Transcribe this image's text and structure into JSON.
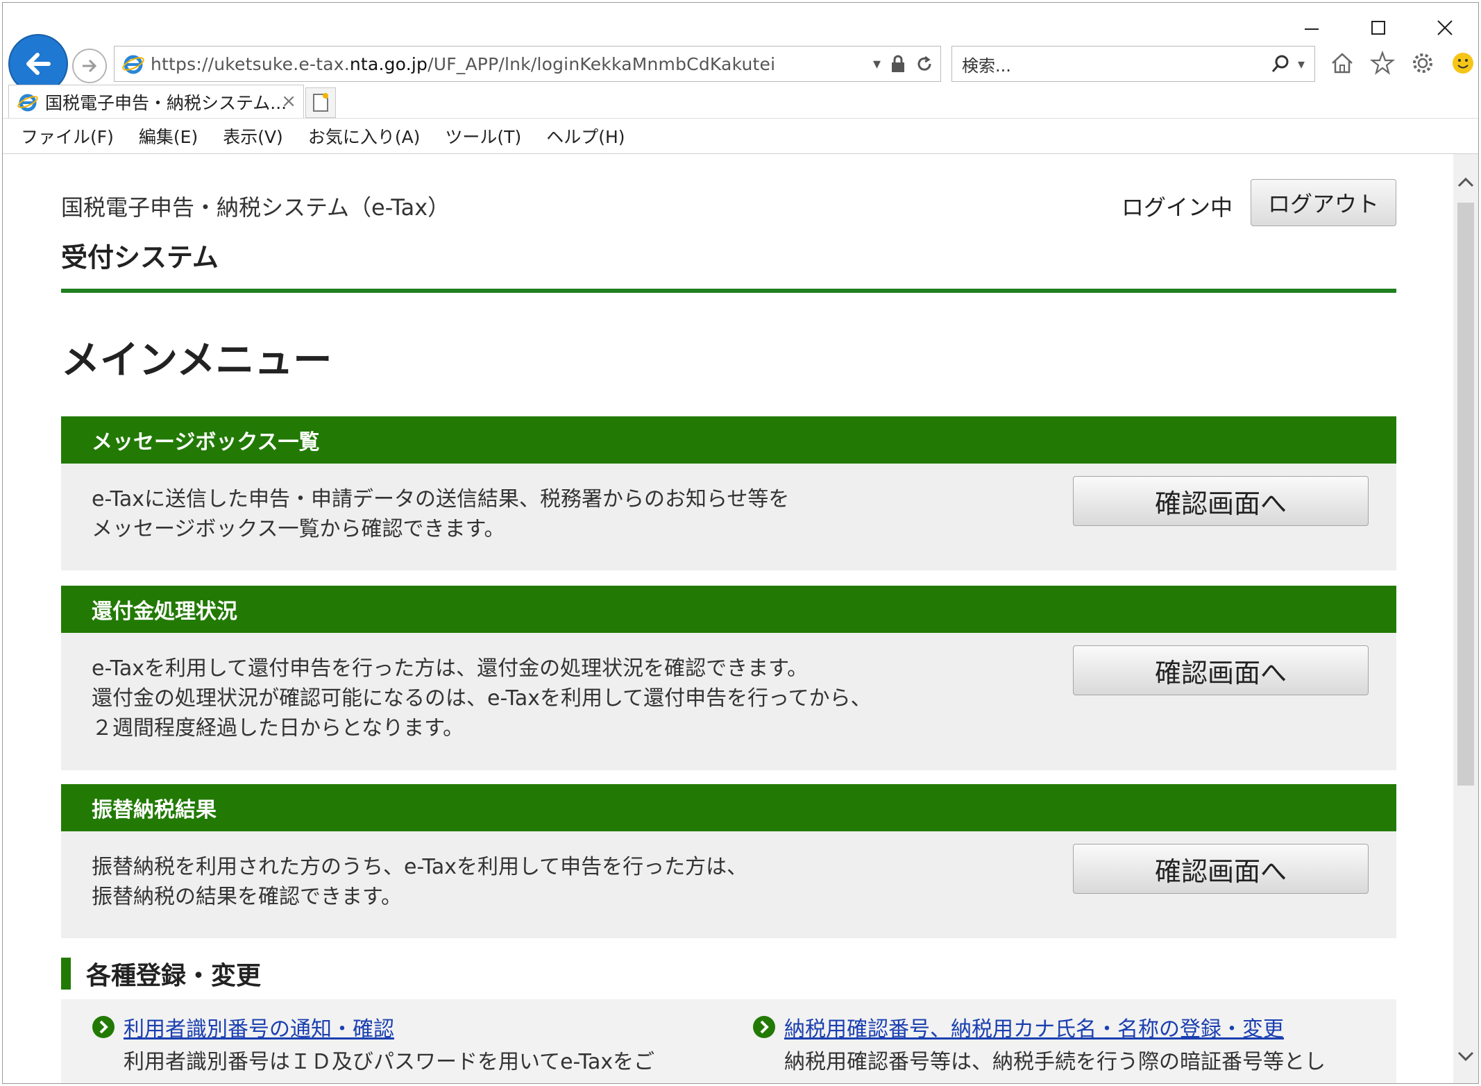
{
  "browser": {
    "url_prefix": "https://uketsuke.e-tax.",
    "url_domain": "nta.go.jp",
    "url_path": "/UF_APP/lnk/loginKekkaMnmbCdKakutei",
    "search_placeholder": "検索...",
    "tab_title": "国税電子申告・納税システム...",
    "menu": [
      "ファイル(F)",
      "編集(E)",
      "表示(V)",
      "お気に入り(A)",
      "ツール(T)",
      "ヘルプ(H)"
    ],
    "tab_close": "×",
    "address_dropdown": "▾"
  },
  "header": {
    "system_title": "国税電子申告・納税システム（e-Tax）",
    "system_subtitle": "受付システム",
    "login_status": "ログイン中",
    "logout_label": "ログアウト"
  },
  "main": {
    "page_title": "メインメニュー",
    "panels": [
      {
        "heading": "メッセージボックス一覧",
        "lines": [
          "e-Taxに送信した申告・申請データの送信結果、税務署からのお知らせ等を",
          "メッセージボックス一覧から確認できます。"
        ],
        "button": "確認画面へ"
      },
      {
        "heading": "還付金処理状況",
        "lines": [
          "e-Taxを利用して還付申告を行った方は、還付金の処理状況を確認できます。",
          "還付金の処理状況が確認可能になるのは、e-Taxを利用して還付申告を行ってから、",
          "２週間程度経過した日からとなります。"
        ],
        "button": "確認画面へ"
      },
      {
        "heading": "振替納税結果",
        "lines": [
          "振替納税を利用された方のうち、e-Taxを利用して申告を行った方は、",
          "振替納税の結果を確認できます。"
        ],
        "button": "確認画面へ"
      }
    ],
    "registration": {
      "heading": "各種登録・変更",
      "items": [
        {
          "link": "利用者識別番号の通知・確認",
          "desc": "利用者識別番号はＩＤ及びパスワードを用いてe-Taxをご"
        },
        {
          "link": "納税用確認番号、納税用カナ氏名・名称の登録・変更",
          "desc": "納税用確認番号等は、納税手続を行う際の暗証番号等とし"
        }
      ]
    }
  },
  "colors": {
    "accent_green": "#227a04",
    "link_blue": "#1a3fb0",
    "back_button_blue": "#1f78d1"
  },
  "icons": [
    "back-arrow-icon",
    "forward-arrow-icon",
    "ie-logo-icon",
    "lock-icon",
    "refresh-icon",
    "search-icon",
    "home-icon",
    "favorites-star-icon",
    "settings-gear-icon",
    "smiley-feedback-icon",
    "new-tab-icon",
    "chevron-right-circle-icon"
  ]
}
